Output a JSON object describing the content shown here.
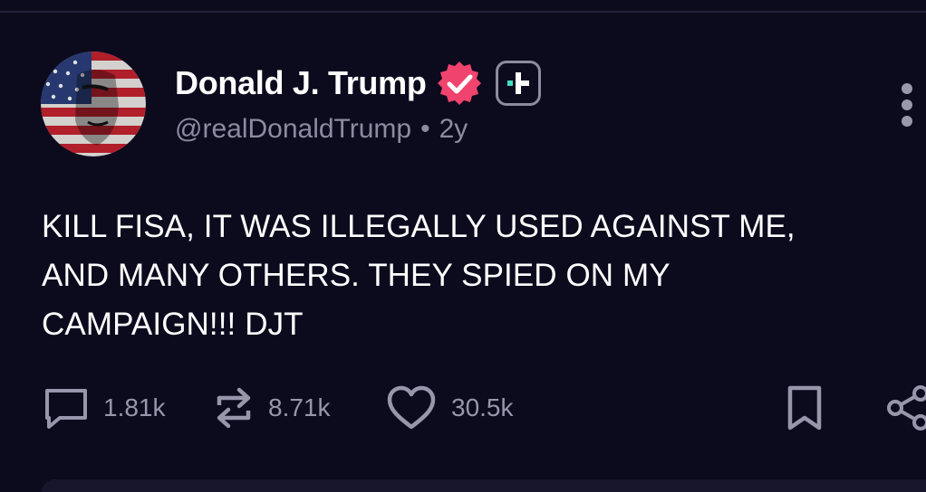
{
  "post": {
    "author": {
      "display_name": "Donald J. Trump",
      "handle": "@realDonaldTrump",
      "time": "2y",
      "separator": "•",
      "verified_icon": "verified-badge-icon",
      "badge_icon": "plus-badge-icon",
      "verified_color": "#f0436e"
    },
    "text_lines": [
      "KILL FISA, IT WAS ILLEGALLY USED AGAINST ME,",
      "AND MANY OTHERS. THEY SPIED ON MY",
      "CAMPAIGN!!! DJT"
    ],
    "actions": {
      "reply_count": "1.81k",
      "repost_count": "8.71k",
      "like_count": "30.5k",
      "reply_icon": "comment-icon",
      "repost_icon": "repost-icon",
      "like_icon": "heart-icon",
      "bookmark_icon": "bookmark-icon",
      "share_icon": "share-icon",
      "more_icon": "more-vertical-icon"
    }
  }
}
